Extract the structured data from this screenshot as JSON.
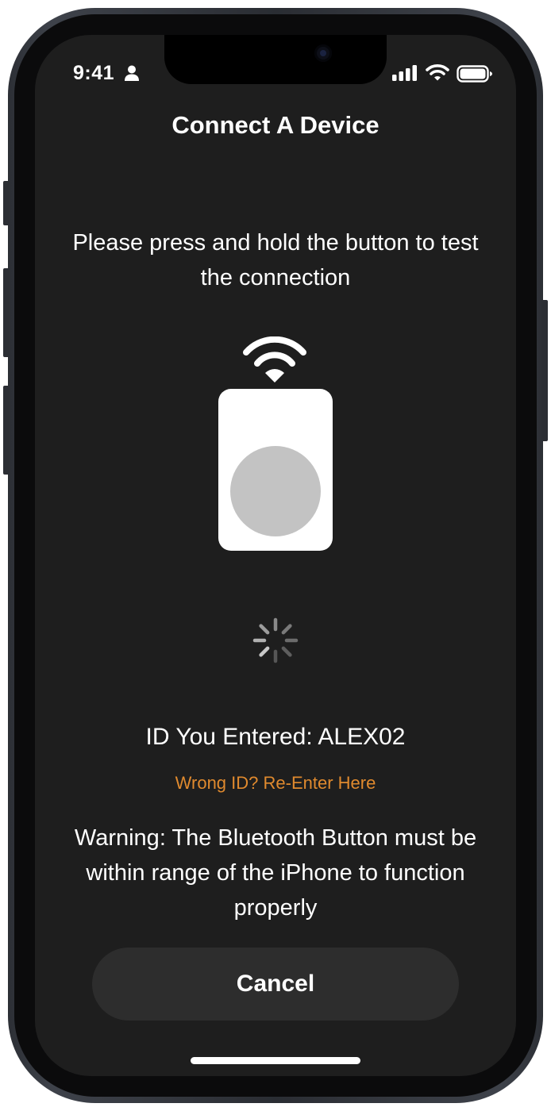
{
  "status_bar": {
    "time": "9:41",
    "icons": [
      "person-icon",
      "cellular-signal-icon",
      "wifi-icon",
      "battery-icon"
    ]
  },
  "screen": {
    "title": "Connect A Device",
    "instructions": "Please press and hold the button to test the connection",
    "illustration": {
      "icons": [
        "wifi-signal-icon",
        "bluetooth-button-device-icon"
      ]
    },
    "loading_indicator": "activity-spinner-icon",
    "id_entered": "ID You Entered: ALEX02",
    "reenter_link": "Wrong ID? Re-Enter Here",
    "warning": "Warning: The Bluetooth Button must be within range of the iPhone to function properly",
    "cancel_label": "Cancel"
  },
  "colors": {
    "background": "#1e1e1e",
    "text": "#ffffff",
    "link_accent": "#e08a2e",
    "button_background": "#2d2d2d",
    "device_body": "#ffffff",
    "device_button": "#c3c3c3"
  }
}
